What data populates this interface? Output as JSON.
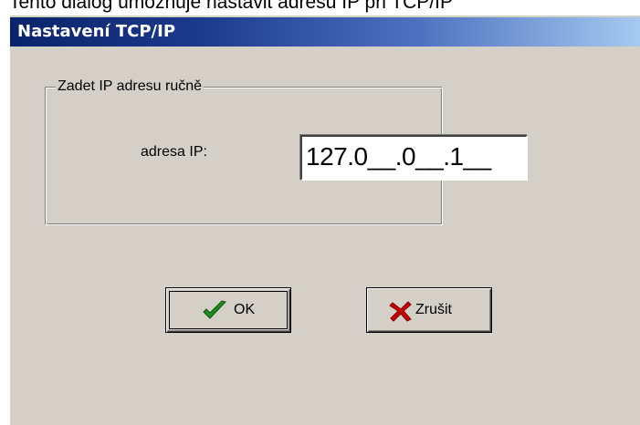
{
  "page_caption": "Tento dialog umožňuje nastavit adresu IP při TCP/IP",
  "dialog": {
    "title": "Nastavení TCP/IP",
    "group_title": "Zadet IP adresu ručně",
    "ip_label": "adresa IP:",
    "ip_value": "127.0__.0__.1__",
    "buttons": {
      "ok_label": "OK",
      "cancel_label": "Zrušit"
    }
  },
  "icons": {
    "ok": "checkmark-icon",
    "cancel": "red-x-icon"
  },
  "colors": {
    "title_bar_start": "#0a246a",
    "title_bar_end": "#a6caf0",
    "dialog_face": "#d4d0c8",
    "checkmark": "#1f8a1f",
    "cancel_x": "#cc0000"
  }
}
